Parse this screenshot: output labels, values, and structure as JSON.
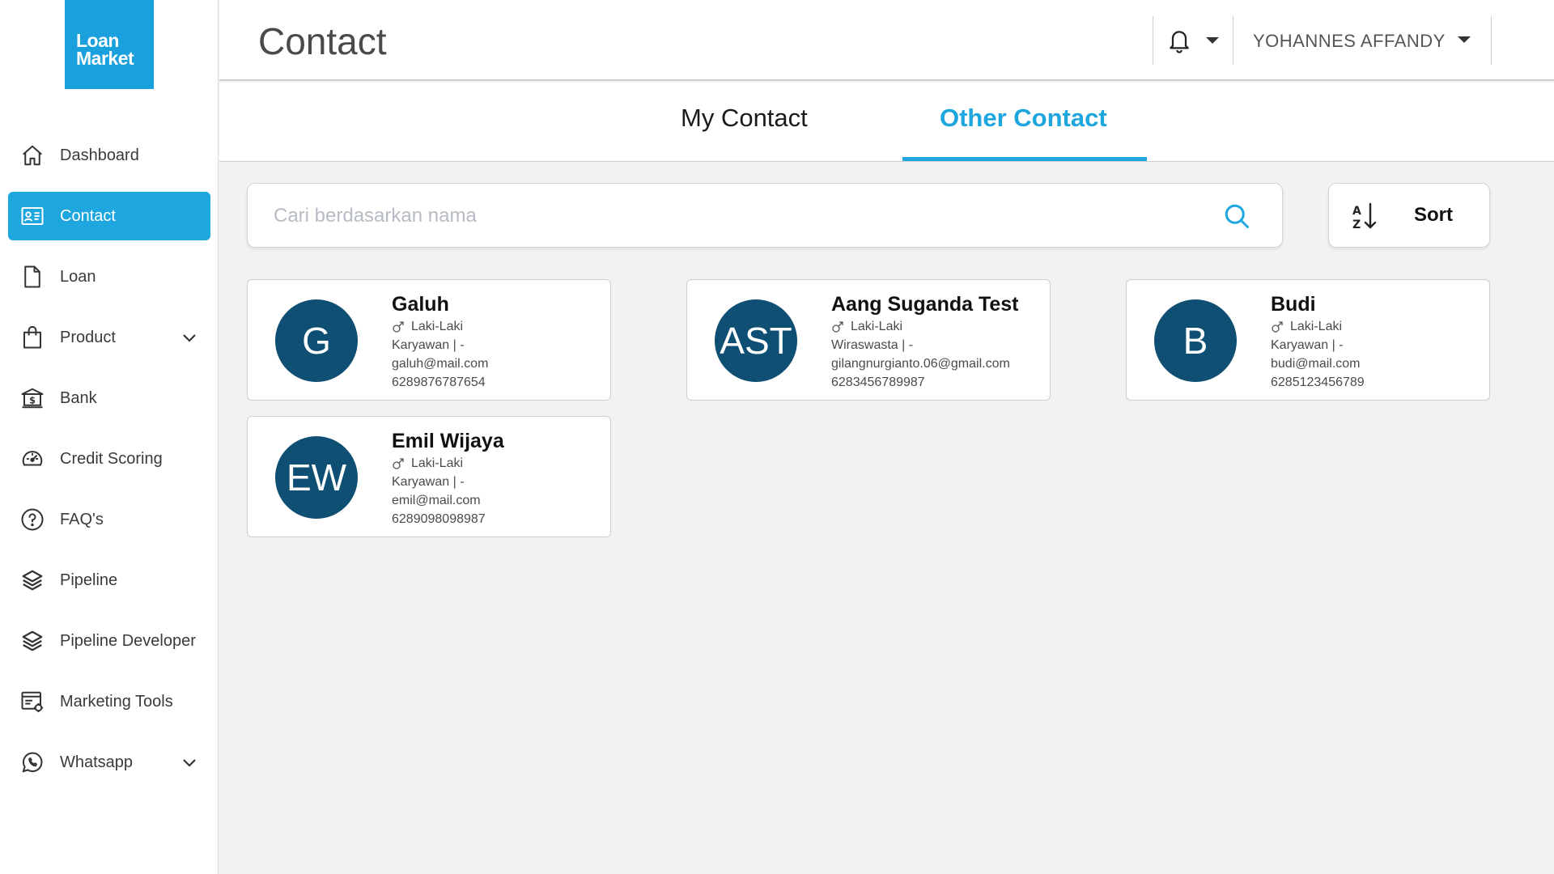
{
  "logo": {
    "line1": "Loan",
    "line2": "Market"
  },
  "sidebar": {
    "items": [
      {
        "label": "Dashboard",
        "icon": "home-icon"
      },
      {
        "label": "Contact",
        "icon": "contact-card-icon",
        "active": true
      },
      {
        "label": "Loan",
        "icon": "document-icon"
      },
      {
        "label": "Product",
        "icon": "shopping-bag-icon",
        "expandable": true
      },
      {
        "label": "Bank",
        "icon": "bank-icon"
      },
      {
        "label": "Credit Scoring",
        "icon": "gauge-icon"
      },
      {
        "label": "FAQ's",
        "icon": "question-circle-icon"
      },
      {
        "label": "Pipeline",
        "icon": "layers-icon"
      },
      {
        "label": "Pipeline Developer",
        "icon": "layers-icon"
      },
      {
        "label": "Marketing Tools",
        "icon": "marketing-tools-icon"
      },
      {
        "label": "Whatsapp",
        "icon": "whatsapp-icon",
        "expandable": true
      }
    ]
  },
  "header": {
    "title": "Contact",
    "user_name": "YOHANNES AFFANDY"
  },
  "tabs": {
    "my_contact": "My Contact",
    "other_contact": "Other Contact",
    "active": "other_contact"
  },
  "search": {
    "placeholder": "Cari berdasarkan nama",
    "value": ""
  },
  "sort": {
    "label": "Sort"
  },
  "contacts": [
    {
      "initials": "G",
      "name": "Galuh",
      "gender": "Laki-Laki",
      "job": "Karyawan | -",
      "email": "galuh@mail.com",
      "phone": "6289876787654"
    },
    {
      "initials": "AST",
      "name": "Aang Suganda Test",
      "gender": "Laki-Laki",
      "job": "Wiraswasta | -",
      "email": "gilangnurgianto.06@gmail.com",
      "phone": "6283456789987"
    },
    {
      "initials": "B",
      "name": "Budi",
      "gender": "Laki-Laki",
      "job": "Karyawan | -",
      "email": "budi@mail.com",
      "phone": "6285123456789"
    },
    {
      "initials": "EW",
      "name": "Emil Wijaya",
      "gender": "Laki-Laki",
      "job": "Karyawan | -",
      "email": "emil@mail.com",
      "phone": "6289098098987"
    }
  ],
  "colors": {
    "accent": "#1ea6de",
    "logo_bg": "#1aa0dc",
    "avatar_bg": "#0e4f73",
    "page_bg": "#f2f2f2"
  }
}
